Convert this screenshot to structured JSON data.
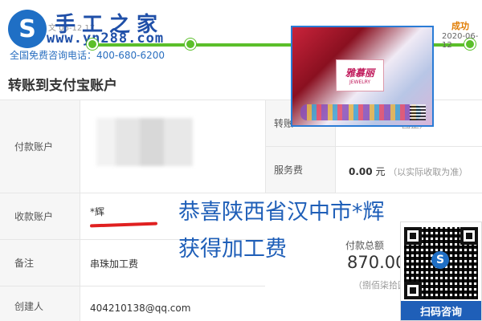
{
  "header": {
    "logo_glyph": "S",
    "brand": "手工之家",
    "url": "www.yn288.com",
    "hotline": "全国免费咨询电话：400-680-6200",
    "ghost_text": "文 06-12 17"
  },
  "progress": {
    "status": "成功",
    "date": "2020-06-12"
  },
  "product_image": {
    "box_title": "雅慕丽",
    "box_sub": "JEWELRY"
  },
  "page": {
    "title": "转账到支付宝账户"
  },
  "form": {
    "payer_label": "付款账户",
    "payee_label": "收款账户",
    "payee_name": "*辉",
    "remark_label": "备注",
    "remark_value": "串珠加工费",
    "creator_label": "创建人",
    "creator_value": "404210138@qq.com"
  },
  "right_panel": {
    "transfer_label": "转账",
    "transfer_note": "图整）",
    "service_fee_label": "服务费",
    "service_fee_amount": "0.00",
    "service_fee_unit": "元",
    "service_fee_note": "（以实际收取为准）"
  },
  "overlay": {
    "line1": "恭喜陕西省汉中市*辉",
    "line2": "获得加工费"
  },
  "payment": {
    "total_label": "付款总额",
    "total_value": "870.00",
    "total_note": "（捌佰柒拾圆"
  },
  "qr": {
    "center_glyph": "S",
    "button_label": "扫码咨询"
  },
  "colors": {
    "brand_blue": "#1f5fb8",
    "progress_green": "#5bbf2a",
    "success_orange": "#e07b00",
    "highlight_red": "#e02020"
  }
}
